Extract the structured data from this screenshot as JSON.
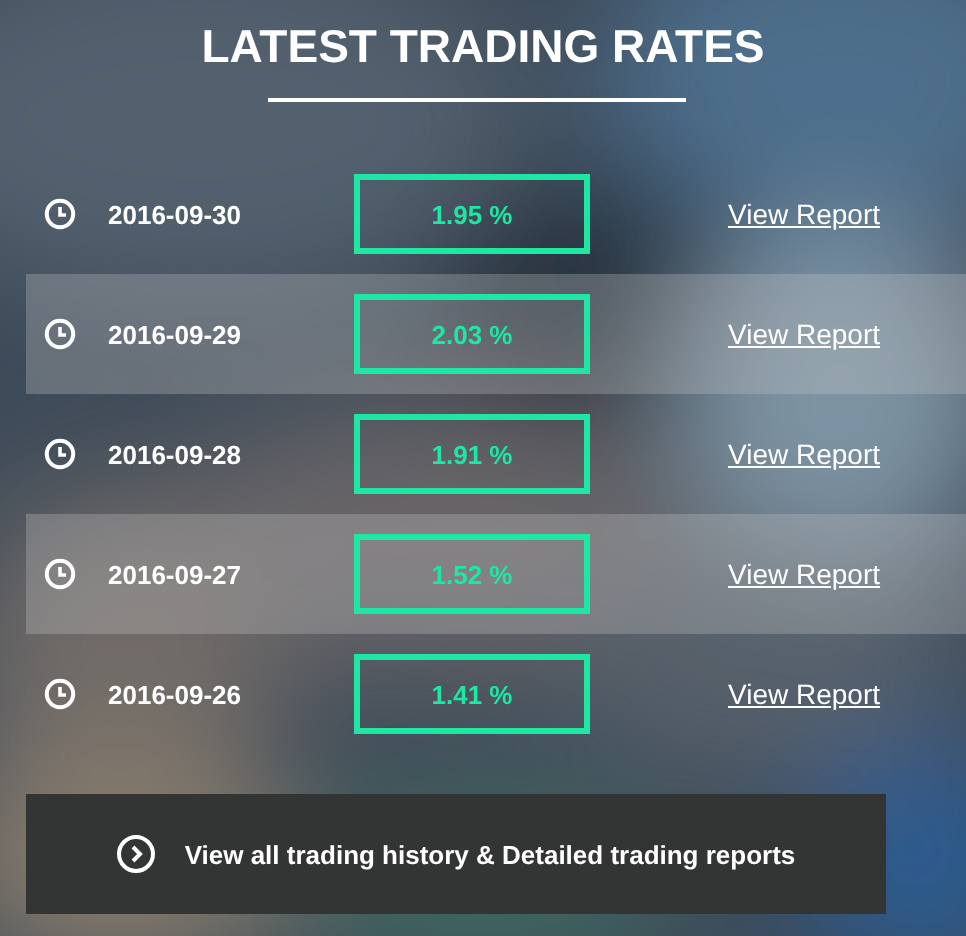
{
  "title": "LATEST TRADING RATES",
  "rates": [
    {
      "date": "2016-09-30",
      "rate": "1.95 %",
      "link": "View Report"
    },
    {
      "date": "2016-09-29",
      "rate": "2.03 %",
      "link": "View Report"
    },
    {
      "date": "2016-09-28",
      "rate": "1.91 %",
      "link": "View Report"
    },
    {
      "date": "2016-09-27",
      "rate": "1.52 %",
      "link": "View Report"
    },
    {
      "date": "2016-09-26",
      "rate": "1.41 %",
      "link": "View Report"
    }
  ],
  "footer_button": "View all trading history & Detailed trading reports"
}
